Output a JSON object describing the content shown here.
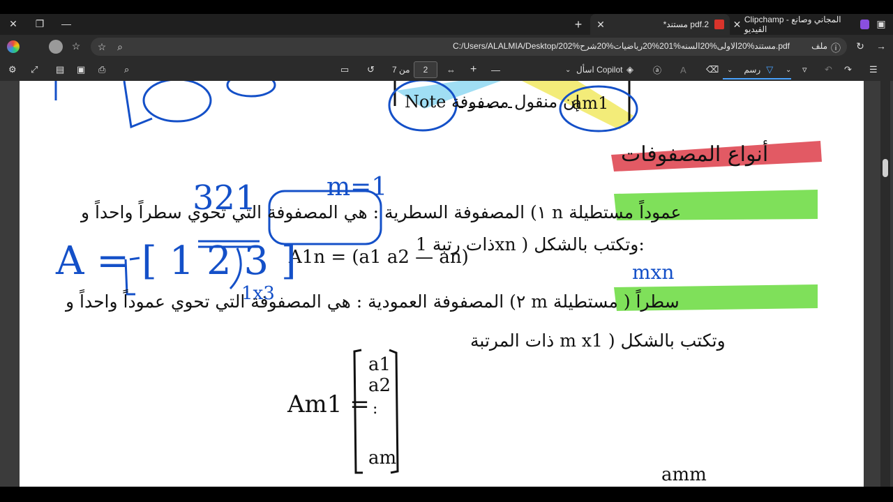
{
  "window": {
    "close": "✕",
    "restore": "❐",
    "minimize": "—"
  },
  "tabs": [
    {
      "title": "*مستند pdf.2",
      "close": "✕"
    },
    {
      "title": "Clipchamp - المجاني وصانع الفيديو",
      "close": "✕"
    }
  ],
  "new_tab": "+",
  "address": {
    "label": "ملف",
    "url": "C:/Users/ALALMIA/Desktop/202%مستند%20الاولى%20السنه%201%20رياضيات%20شرح.pdf"
  },
  "toolbar": {
    "draw_label": "رسم",
    "copilot_label": "اسأل Copilot",
    "page_current": "2",
    "page_of": "من 7",
    "zoom_in": "+",
    "zoom_out": "—"
  },
  "document": {
    "lines": [
      "أنواع المصفوفات",
      "١) المصفوفة السطرية : هي المصفوفة التي تحوي سطراً واحداً و n عموداً مستطيلة",
      "ذات رتبة 1xn ) وتكتب بالشكل:",
      "A1n = (a1  a2 — an)",
      "m=1",
      "321",
      "A = [ 1  2  3 ]",
      "1x3",
      "mxn",
      "٢) المصفوفة العمودية : هي المصفوفة التي تحوي عموداً واحداً و m سطراً ( مستطيلة",
      "ذات المرتبة  m x1 ) وتكتب بالشكل",
      "Am1 =",
      "a1",
      "a2",
      ":",
      "am",
      "Note إن منقول مصفوفة",
      "am1",
      "amm"
    ]
  },
  "colors": {
    "highlight_red": "#e25a64",
    "highlight_green": "#7fe05a",
    "highlight_yellow": "#f2ea6a",
    "highlight_cyan": "#8fd8f2",
    "ink_blue": "#1450c8"
  }
}
